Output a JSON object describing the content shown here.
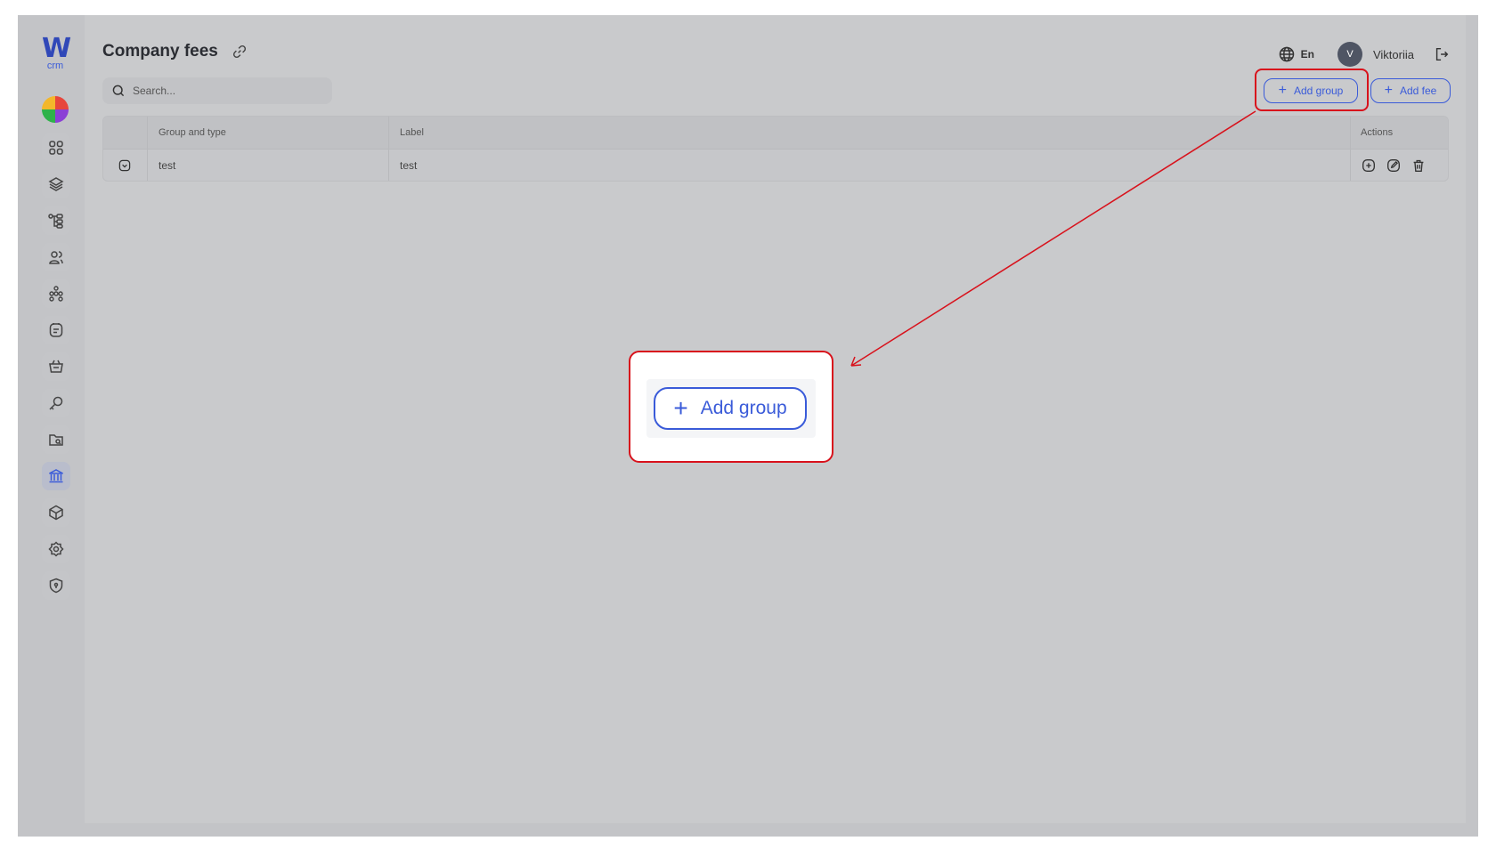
{
  "app": {
    "logo_letter": "W",
    "logo_sub": "crm"
  },
  "page": {
    "title": "Company fees"
  },
  "search": {
    "placeholder": "Search..."
  },
  "header": {
    "language": "En",
    "avatar_initial": "V",
    "user_name": "Viktoriia"
  },
  "toolbar": {
    "add_group_label": "Add group",
    "add_fee_label": "Add fee"
  },
  "sidebar": {
    "items": [
      {
        "icon": "dashboard-grid-icon"
      },
      {
        "icon": "layers-icon"
      },
      {
        "icon": "hierarchy-icon"
      },
      {
        "icon": "users-icon"
      },
      {
        "icon": "team-structure-icon"
      },
      {
        "icon": "notes-icon"
      },
      {
        "icon": "basket-icon"
      },
      {
        "icon": "key-icon"
      },
      {
        "icon": "folder-search-icon"
      },
      {
        "icon": "bank-icon",
        "active": true
      },
      {
        "icon": "cube-icon"
      },
      {
        "icon": "settings-icon"
      },
      {
        "icon": "shield-icon"
      }
    ]
  },
  "table": {
    "columns": [
      "Group and type",
      "Label",
      "Actions"
    ],
    "rows": [
      {
        "group_type": "test",
        "label": "test"
      }
    ]
  },
  "callout": {
    "label": "Add group"
  },
  "colors": {
    "accent": "#3a5bd9",
    "highlight": "#d8121c",
    "overlay": "#c9cacc"
  }
}
